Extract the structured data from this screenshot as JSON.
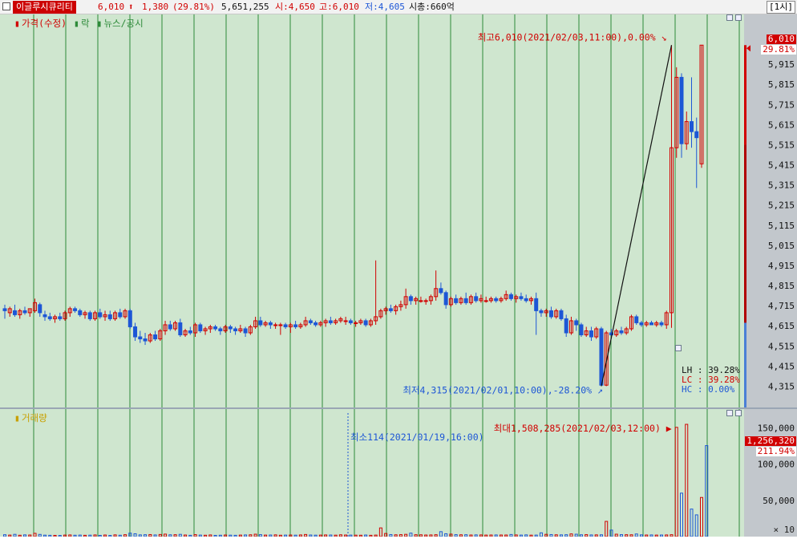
{
  "header": {
    "stock_name": "이글루시큐리티",
    "price": "6,010",
    "change_arrow": "⬆",
    "change": "1,380",
    "change_pct": "(29.81%)",
    "volume": "5,651,255",
    "open": "시:4,650",
    "high": "고:6,010",
    "low": "저:4,605",
    "market_cap": "시총:660억",
    "period": "[1시]"
  },
  "legend": {
    "price_label": "가격(수정)",
    "rak_label": "락",
    "news_label": "뉴스/공시",
    "volume_label": "거래량"
  },
  "annotations": {
    "max_price": "최고6,010(2021/02/03,11:00),0.00%",
    "min_price": "최저4,315(2021/02/01,10:00),-28.20%",
    "max_volume": "최대1,508,285(2021/02/03,12:00)",
    "min_volume": "최소114(2021/01/19,16:00)"
  },
  "stats": {
    "lh": "LH : 39.28%",
    "lc": "LC : 39.28%",
    "hc": "HC :  0.00%"
  },
  "price_axis": {
    "ticks": [
      "5,915",
      "5,815",
      "5,715",
      "5,615",
      "5,515",
      "5,415",
      "5,315",
      "5,215",
      "5,115",
      "5,015",
      "4,915",
      "4,815",
      "4,715",
      "4,615",
      "4,515",
      "4,415",
      "4,315"
    ],
    "current_label": "6,010",
    "current_pct": "29.81%"
  },
  "volume_axis": {
    "ticks": [
      "150,000",
      "100,000",
      "50,000"
    ],
    "multiplier": "× 10",
    "current_label": "1,256,320",
    "current_pct": "211.94%"
  },
  "colors": {
    "up": "#d10000",
    "down": "#1d56d6",
    "bg": "#cfe6cf",
    "grid": "#2e8b3a"
  },
  "chart_data": {
    "type": "candlestick",
    "price_range": [
      4265,
      6035
    ],
    "volume_range_x10": [
      0,
      165000
    ],
    "candles": [
      {
        "o": 4700,
        "h": 4720,
        "l": 4650,
        "c": 4690
      },
      {
        "o": 4680,
        "h": 4710,
        "l": 4660,
        "c": 4700
      },
      {
        "o": 4690,
        "h": 4720,
        "l": 4660,
        "c": 4670
      },
      {
        "o": 4670,
        "h": 4700,
        "l": 4650,
        "c": 4690
      },
      {
        "o": 4690,
        "h": 4710,
        "l": 4670,
        "c": 4680
      },
      {
        "o": 4680,
        "h": 4700,
        "l": 4660,
        "c": 4700
      },
      {
        "o": 4690,
        "h": 4750,
        "l": 4680,
        "c": 4730
      },
      {
        "o": 4720,
        "h": 4730,
        "l": 4660,
        "c": 4680
      },
      {
        "o": 4670,
        "h": 4690,
        "l": 4640,
        "c": 4660
      },
      {
        "o": 4660,
        "h": 4680,
        "l": 4640,
        "c": 4650
      },
      {
        "o": 4650,
        "h": 4670,
        "l": 4630,
        "c": 4660
      },
      {
        "o": 4660,
        "h": 4680,
        "l": 4640,
        "c": 4650
      },
      {
        "o": 4650,
        "h": 4690,
        "l": 4640,
        "c": 4680
      },
      {
        "o": 4680,
        "h": 4710,
        "l": 4660,
        "c": 4700
      },
      {
        "o": 4700,
        "h": 4710,
        "l": 4680,
        "c": 4690
      },
      {
        "o": 4690,
        "h": 4700,
        "l": 4660,
        "c": 4670
      },
      {
        "o": 4670,
        "h": 4690,
        "l": 4650,
        "c": 4680
      },
      {
        "o": 4680,
        "h": 4690,
        "l": 4640,
        "c": 4650
      },
      {
        "o": 4650,
        "h": 4690,
        "l": 4640,
        "c": 4680
      },
      {
        "o": 4680,
        "h": 4700,
        "l": 4650,
        "c": 4660
      },
      {
        "o": 4660,
        "h": 4690,
        "l": 4640,
        "c": 4670
      },
      {
        "o": 4670,
        "h": 4690,
        "l": 4640,
        "c": 4650
      },
      {
        "o": 4650,
        "h": 4690,
        "l": 4640,
        "c": 4680
      },
      {
        "o": 4680,
        "h": 4700,
        "l": 4650,
        "c": 4660
      },
      {
        "o": 4660,
        "h": 4700,
        "l": 4650,
        "c": 4690
      },
      {
        "o": 4690,
        "h": 4700,
        "l": 4600,
        "c": 4610
      },
      {
        "o": 4610,
        "h": 4630,
        "l": 4540,
        "c": 4560
      },
      {
        "o": 4560,
        "h": 4590,
        "l": 4530,
        "c": 4550
      },
      {
        "o": 4550,
        "h": 4580,
        "l": 4520,
        "c": 4540
      },
      {
        "o": 4540,
        "h": 4580,
        "l": 4530,
        "c": 4570
      },
      {
        "o": 4570,
        "h": 4590,
        "l": 4540,
        "c": 4550
      },
      {
        "o": 4550,
        "h": 4600,
        "l": 4540,
        "c": 4590
      },
      {
        "o": 4590,
        "h": 4640,
        "l": 4570,
        "c": 4620
      },
      {
        "o": 4620,
        "h": 4640,
        "l": 4590,
        "c": 4600
      },
      {
        "o": 4600,
        "h": 4640,
        "l": 4590,
        "c": 4630
      },
      {
        "o": 4630,
        "h": 4650,
        "l": 4560,
        "c": 4570
      },
      {
        "o": 4570,
        "h": 4600,
        "l": 4560,
        "c": 4590
      },
      {
        "o": 4590,
        "h": 4610,
        "l": 4570,
        "c": 4580
      },
      {
        "o": 4580,
        "h": 4630,
        "l": 4560,
        "c": 4620
      },
      {
        "o": 4620,
        "h": 4630,
        "l": 4580,
        "c": 4590
      },
      {
        "o": 4590,
        "h": 4610,
        "l": 4570,
        "c": 4600
      },
      {
        "o": 4600,
        "h": 4620,
        "l": 4580,
        "c": 4610
      },
      {
        "o": 4610,
        "h": 4620,
        "l": 4590,
        "c": 4600
      },
      {
        "o": 4600,
        "h": 4610,
        "l": 4570,
        "c": 4590
      },
      {
        "o": 4590,
        "h": 4620,
        "l": 4580,
        "c": 4610
      },
      {
        "o": 4610,
        "h": 4620,
        "l": 4580,
        "c": 4600
      },
      {
        "o": 4600,
        "h": 4610,
        "l": 4570,
        "c": 4590
      },
      {
        "o": 4590,
        "h": 4620,
        "l": 4580,
        "c": 4600
      },
      {
        "o": 4600,
        "h": 4610,
        "l": 4560,
        "c": 4580
      },
      {
        "o": 4580,
        "h": 4620,
        "l": 4570,
        "c": 4610
      },
      {
        "o": 4610,
        "h": 4660,
        "l": 4600,
        "c": 4640
      },
      {
        "o": 4640,
        "h": 4660,
        "l": 4610,
        "c": 4620
      },
      {
        "o": 4620,
        "h": 4640,
        "l": 4610,
        "c": 4630
      },
      {
        "o": 4630,
        "h": 4640,
        "l": 4600,
        "c": 4620
      },
      {
        "o": 4620,
        "h": 4630,
        "l": 4600,
        "c": 4620
      },
      {
        "o": 4620,
        "h": 4630,
        "l": 4570,
        "c": 4620
      },
      {
        "o": 4620,
        "h": 4630,
        "l": 4600,
        "c": 4610
      },
      {
        "o": 4610,
        "h": 4630,
        "l": 4580,
        "c": 4620
      },
      {
        "o": 4620,
        "h": 4640,
        "l": 4600,
        "c": 4610
      },
      {
        "o": 4610,
        "h": 4630,
        "l": 4600,
        "c": 4620
      },
      {
        "o": 4620,
        "h": 4660,
        "l": 4610,
        "c": 4640
      },
      {
        "o": 4640,
        "h": 4650,
        "l": 4620,
        "c": 4630
      },
      {
        "o": 4630,
        "h": 4640,
        "l": 4610,
        "c": 4620
      },
      {
        "o": 4620,
        "h": 4640,
        "l": 4610,
        "c": 4630
      },
      {
        "o": 4630,
        "h": 4650,
        "l": 4610,
        "c": 4640
      },
      {
        "o": 4640,
        "h": 4660,
        "l": 4620,
        "c": 4630
      },
      {
        "o": 4630,
        "h": 4650,
        "l": 4620,
        "c": 4640
      },
      {
        "o": 4640,
        "h": 4660,
        "l": 4630,
        "c": 4650
      },
      {
        "o": 4640,
        "h": 4660,
        "l": 4620,
        "c": 4640
      },
      {
        "o": 4640,
        "h": 4650,
        "l": 4620,
        "c": 4630
      },
      {
        "o": 4630,
        "h": 4640,
        "l": 4610,
        "c": 4630
      },
      {
        "o": 4630,
        "h": 4650,
        "l": 4620,
        "c": 4640
      },
      {
        "o": 4640,
        "h": 4650,
        "l": 4610,
        "c": 4620
      },
      {
        "o": 4620,
        "h": 4650,
        "l": 4610,
        "c": 4640
      },
      {
        "o": 4640,
        "h": 4940,
        "l": 4620,
        "c": 4660
      },
      {
        "o": 4660,
        "h": 4700,
        "l": 4650,
        "c": 4690
      },
      {
        "o": 4690,
        "h": 4710,
        "l": 4670,
        "c": 4700
      },
      {
        "o": 4700,
        "h": 4720,
        "l": 4680,
        "c": 4690
      },
      {
        "o": 4690,
        "h": 4720,
        "l": 4670,
        "c": 4710
      },
      {
        "o": 4710,
        "h": 4740,
        "l": 4690,
        "c": 4720
      },
      {
        "o": 4720,
        "h": 4800,
        "l": 4700,
        "c": 4760
      },
      {
        "o": 4760,
        "h": 4770,
        "l": 4720,
        "c": 4740
      },
      {
        "o": 4740,
        "h": 4760,
        "l": 4720,
        "c": 4750
      },
      {
        "o": 4740,
        "h": 4760,
        "l": 4730,
        "c": 4740
      },
      {
        "o": 4740,
        "h": 4750,
        "l": 4720,
        "c": 4740
      },
      {
        "o": 4740,
        "h": 4770,
        "l": 4720,
        "c": 4760
      },
      {
        "o": 4760,
        "h": 4890,
        "l": 4740,
        "c": 4800
      },
      {
        "o": 4800,
        "h": 4830,
        "l": 4770,
        "c": 4780
      },
      {
        "o": 4780,
        "h": 4790,
        "l": 4700,
        "c": 4720
      },
      {
        "o": 4720,
        "h": 4760,
        "l": 4710,
        "c": 4750
      },
      {
        "o": 4750,
        "h": 4770,
        "l": 4720,
        "c": 4730
      },
      {
        "o": 4730,
        "h": 4760,
        "l": 4720,
        "c": 4750
      },
      {
        "o": 4750,
        "h": 4780,
        "l": 4720,
        "c": 4730
      },
      {
        "o": 4730,
        "h": 4770,
        "l": 4720,
        "c": 4760
      },
      {
        "o": 4760,
        "h": 4780,
        "l": 4730,
        "c": 4740
      },
      {
        "o": 4740,
        "h": 4770,
        "l": 4730,
        "c": 4750
      },
      {
        "o": 4740,
        "h": 4760,
        "l": 4730,
        "c": 4740
      },
      {
        "o": 4740,
        "h": 4760,
        "l": 4730,
        "c": 4750
      },
      {
        "o": 4750,
        "h": 4760,
        "l": 4730,
        "c": 4740
      },
      {
        "o": 4740,
        "h": 4760,
        "l": 4730,
        "c": 4750
      },
      {
        "o": 4750,
        "h": 4790,
        "l": 4740,
        "c": 4770
      },
      {
        "o": 4770,
        "h": 4780,
        "l": 4740,
        "c": 4750
      },
      {
        "o": 4750,
        "h": 4770,
        "l": 4730,
        "c": 4760
      },
      {
        "o": 4760,
        "h": 4780,
        "l": 4740,
        "c": 4750
      },
      {
        "o": 4750,
        "h": 4770,
        "l": 4730,
        "c": 4740
      },
      {
        "o": 4740,
        "h": 4760,
        "l": 4720,
        "c": 4750
      },
      {
        "o": 4750,
        "h": 4780,
        "l": 4570,
        "c": 4690
      },
      {
        "o": 4690,
        "h": 4700,
        "l": 4660,
        "c": 4680
      },
      {
        "o": 4680,
        "h": 4700,
        "l": 4660,
        "c": 4690
      },
      {
        "o": 4690,
        "h": 4710,
        "l": 4650,
        "c": 4660
      },
      {
        "o": 4660,
        "h": 4700,
        "l": 4650,
        "c": 4690
      },
      {
        "o": 4690,
        "h": 4700,
        "l": 4640,
        "c": 4650
      },
      {
        "o": 4650,
        "h": 4670,
        "l": 4560,
        "c": 4580
      },
      {
        "o": 4580,
        "h": 4660,
        "l": 4570,
        "c": 4640
      },
      {
        "o": 4640,
        "h": 4650,
        "l": 4590,
        "c": 4620
      },
      {
        "o": 4620,
        "h": 4630,
        "l": 4560,
        "c": 4570
      },
      {
        "o": 4570,
        "h": 4610,
        "l": 4560,
        "c": 4590
      },
      {
        "o": 4590,
        "h": 4610,
        "l": 4540,
        "c": 4560
      },
      {
        "o": 4560,
        "h": 4610,
        "l": 4550,
        "c": 4600
      },
      {
        "o": 4600,
        "h": 4610,
        "l": 4315,
        "c": 4320
      },
      {
        "o": 4320,
        "h": 4590,
        "l": 4315,
        "c": 4580
      },
      {
        "o": 4580,
        "h": 4600,
        "l": 4550,
        "c": 4570
      },
      {
        "o": 4570,
        "h": 4600,
        "l": 4560,
        "c": 4590
      },
      {
        "o": 4590,
        "h": 4610,
        "l": 4570,
        "c": 4580
      },
      {
        "o": 4580,
        "h": 4610,
        "l": 4570,
        "c": 4600
      },
      {
        "o": 4600,
        "h": 4670,
        "l": 4590,
        "c": 4660
      },
      {
        "o": 4660,
        "h": 4670,
        "l": 4620,
        "c": 4630
      },
      {
        "o": 4630,
        "h": 4640,
        "l": 4610,
        "c": 4620
      },
      {
        "o": 4620,
        "h": 4640,
        "l": 4610,
        "c": 4630
      },
      {
        "o": 4630,
        "h": 4640,
        "l": 4620,
        "c": 4620
      },
      {
        "o": 4620,
        "h": 4640,
        "l": 4610,
        "c": 4630
      },
      {
        "o": 4630,
        "h": 4640,
        "l": 4610,
        "c": 4620
      },
      {
        "o": 4620,
        "h": 4690,
        "l": 4600,
        "c": 4680
      },
      {
        "o": 4680,
        "h": 6010,
        "l": 4605,
        "c": 5500
      },
      {
        "o": 5500,
        "h": 5900,
        "l": 5450,
        "c": 5850
      },
      {
        "o": 5850,
        "h": 5870,
        "l": 5450,
        "c": 5520
      },
      {
        "o": 5520,
        "h": 5680,
        "l": 5490,
        "c": 5630
      },
      {
        "o": 5630,
        "h": 5850,
        "l": 5500,
        "c": 5580
      },
      {
        "o": 5580,
        "h": 5650,
        "l": 5300,
        "c": 5550
      },
      {
        "o": 5420,
        "h": 6010,
        "l": 5400,
        "c": 6010
      }
    ],
    "volumes": [
      2600,
      2100,
      3100,
      1900,
      2400,
      2200,
      4500,
      3000,
      2000,
      1800,
      1700,
      1600,
      2100,
      2300,
      1900,
      2100,
      1800,
      2000,
      2300,
      1700,
      2200,
      1600,
      2400,
      1900,
      2600,
      4800,
      3900,
      2400,
      2600,
      2800,
      2300,
      2900,
      3400,
      2500,
      2600,
      3100,
      2200,
      1800,
      2700,
      2100,
      1900,
      2300,
      1700,
      1900,
      2200,
      2000,
      1800,
      2100,
      2300,
      2500,
      3300,
      2700,
      2100,
      2200,
      2400,
      1900,
      2100,
      2200,
      2000,
      2300,
      2900,
      2200,
      2000,
      2100,
      2300,
      2200,
      2000,
      2500,
      2200,
      2100,
      2000,
      1900,
      2200,
      1800,
      2100,
      12000,
      4300,
      2800,
      2500,
      2700,
      3100,
      4800,
      2600,
      2500,
      2200,
      2300,
      2600,
      6800,
      3900,
      3400,
      2700,
      2500,
      2600,
      2200,
      2400,
      2300,
      2100,
      2200,
      2300,
      2200,
      2200,
      2900,
      2300,
      2100,
      2400,
      2000,
      2100,
      5200,
      3100,
      2800,
      2500,
      2400,
      2600,
      3700,
      3300,
      2500,
      2700,
      2300,
      2400,
      2500,
      21000,
      9000,
      3300,
      2700,
      2600,
      2500,
      3600,
      2400,
      2200,
      2300,
      2100,
      2200,
      2300,
      2600,
      150828,
      60000,
      155000,
      38000,
      30000,
      54000,
      125632
    ],
    "up_color": "#d10000",
    "down_color": "#1d56d6"
  }
}
